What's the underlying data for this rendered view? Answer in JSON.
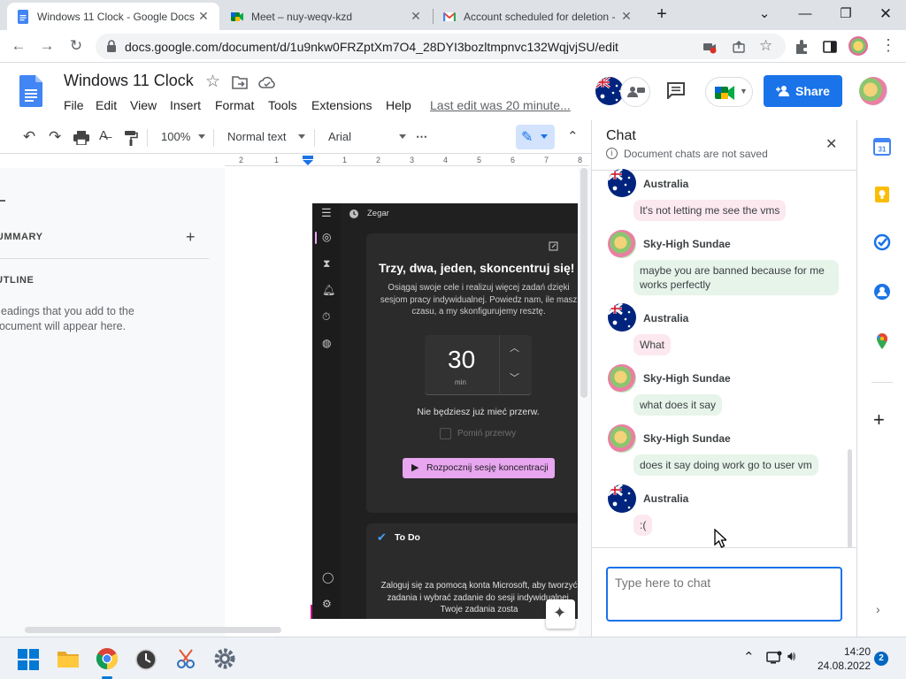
{
  "browser": {
    "tabs": [
      {
        "title": "Windows 11 Clock - Google Docs",
        "active": true
      },
      {
        "title": "Meet – nuy-weqv-kzd",
        "active": false
      },
      {
        "title": "Account scheduled for deletion -",
        "active": false
      }
    ],
    "new_tab": "+",
    "url": "docs.google.com/document/d/1u9nkw0FRZptXm7O4_28DYI3bozltmpnvc132WqjvjSU/edit"
  },
  "docs": {
    "title": "Windows 11 Clock",
    "menu": [
      "File",
      "Edit",
      "View",
      "Insert",
      "Format",
      "Tools",
      "Extensions",
      "Help"
    ],
    "last_edit": "Last edit was 20 minute...",
    "share_label": "Share",
    "toolbar": {
      "zoom": "100%",
      "style": "Normal text",
      "font": "Arial",
      "more": "⋯"
    },
    "ruler": [
      "2",
      "1",
      "1",
      "2",
      "3",
      "4",
      "5",
      "6",
      "7",
      "8"
    ],
    "outline": {
      "summary_label": "SUMMARY",
      "outline_label": "OUTLINE",
      "hint": "Headings that you add to the document will appear here."
    }
  },
  "clock_app": {
    "title": "Zegar",
    "heading": "Trzy, dwa, jeden, skoncentruj się!",
    "description": "Osiągaj swoje cele i realizuj więcej zadań dzięki sesjom pracy indywidualnej. Powiedz nam, ile masz czasu, a my skonfigurujemy resztę.",
    "timer_value": "30",
    "timer_unit": "min",
    "break_note": "Nie będziesz już mieć przerw.",
    "skip_breaks": "Pomiń przerwy",
    "start_button": "Rozpocznij sesję koncentracji",
    "todo_title": "To Do",
    "todo_text": "Zaloguj się za pomocą konta Microsoft, aby tworzyć zadania i wybrać zadanie do sesji indywidualnej. Twoje zadania zosta"
  },
  "chat": {
    "title": "Chat",
    "subtitle": "Document chats are not saved",
    "placeholder": "Type here to chat",
    "messages": [
      {
        "author": "Australia",
        "text": "It's not letting me see the vms"
      },
      {
        "author": "Sky-High Sundae",
        "text": "maybe you are banned because for me works perfectly"
      },
      {
        "author": "Australia",
        "text": "What"
      },
      {
        "author": "Sky-High Sundae",
        "text": "what does it say"
      },
      {
        "author": "Sky-High Sundae",
        "text": "does it say doing work go to user vm"
      },
      {
        "author": "Australia",
        "text": ":("
      }
    ]
  },
  "taskbar": {
    "time": "14:20",
    "date": "24.08.2022",
    "notifications": "2"
  },
  "colors": {
    "docs_blue": "#1a73e8",
    "chat_green": "#e6f4ea",
    "chat_pink": "#fce8ef",
    "clock_bg": "#202020",
    "clock_accent": "#e8a5f0"
  }
}
